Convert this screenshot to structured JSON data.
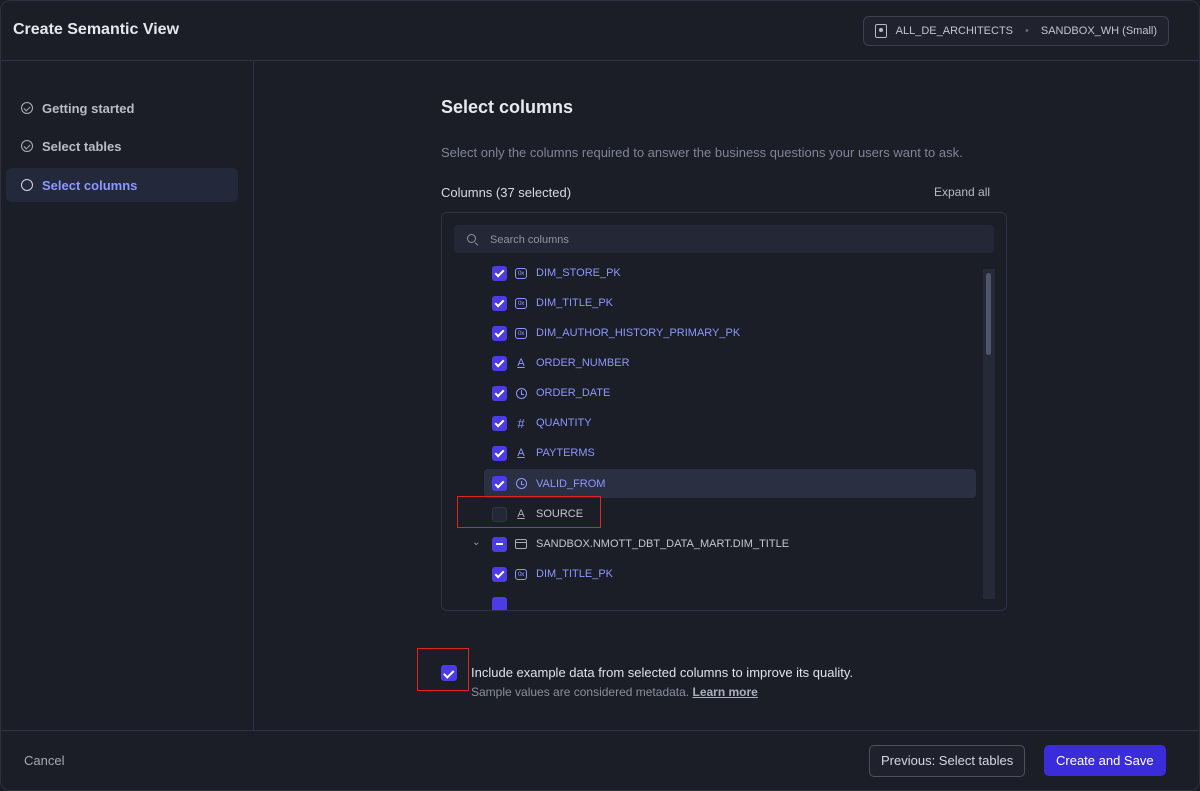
{
  "header": {
    "title": "Create Semantic View",
    "role": "ALL_DE_ARCHITECTS",
    "separator": "•",
    "warehouse": "SANDBOX_WH (Small)"
  },
  "sidebar": {
    "steps": [
      {
        "label": "Getting started",
        "state": "done",
        "icon": "check-circle-icon"
      },
      {
        "label": "Select tables",
        "state": "done",
        "icon": "check-circle-icon"
      },
      {
        "label": "Select columns",
        "state": "active",
        "icon": "circle-icon"
      }
    ]
  },
  "main": {
    "title": "Select columns",
    "description": "Select only the columns required to answer the business questions your users want to ask.",
    "columns_header": "Columns (37 selected)",
    "expand_all": "Expand all",
    "search_placeholder": "Search columns",
    "rows": [
      {
        "name": "DIM_STORE_PK",
        "type_icon": "binary-icon",
        "type_glyph": "0x",
        "checked": true
      },
      {
        "name": "DIM_TITLE_PK",
        "type_icon": "binary-icon",
        "type_glyph": "0x",
        "checked": true
      },
      {
        "name": "DIM_AUTHOR_HISTORY_PRIMARY_PK",
        "type_icon": "binary-icon",
        "type_glyph": "0x",
        "checked": true
      },
      {
        "name": "ORDER_NUMBER",
        "type_icon": "text-icon",
        "type_glyph": "A",
        "checked": true
      },
      {
        "name": "ORDER_DATE",
        "type_icon": "clock-icon",
        "type_glyph": "",
        "checked": true
      },
      {
        "name": "QUANTITY",
        "type_icon": "hash-icon",
        "type_glyph": "#",
        "checked": true
      },
      {
        "name": "PAYTERMS",
        "type_icon": "text-icon",
        "type_glyph": "A",
        "checked": true
      },
      {
        "name": "VALID_FROM",
        "type_icon": "clock-icon",
        "type_glyph": "",
        "checked": true,
        "highlighted": true
      },
      {
        "name": "SOURCE",
        "type_icon": "text-icon",
        "type_glyph": "A",
        "checked": false
      },
      {
        "name": "SANDBOX.NMOTT_DBT_DATA_MART.DIM_TITLE",
        "type_icon": "table-icon",
        "type_glyph": "",
        "checked": "partial",
        "expander": "⌄"
      },
      {
        "name": "DIM_TITLE_PK",
        "type_icon": "binary-icon",
        "type_glyph": "0x",
        "checked": true
      }
    ],
    "include_example": {
      "checked": true,
      "label": "Include example data from selected columns to improve its quality.",
      "sub_text": "Sample values are considered metadata.",
      "learn_more": "Learn more"
    }
  },
  "footer": {
    "cancel": "Cancel",
    "previous": "Previous: Select tables",
    "create": "Create and Save"
  },
  "colors": {
    "accent": "#4c3ce6",
    "accent_text": "#8d97ff",
    "primary_button": "#3a2bdb",
    "annotation_red": "#e2241f"
  }
}
